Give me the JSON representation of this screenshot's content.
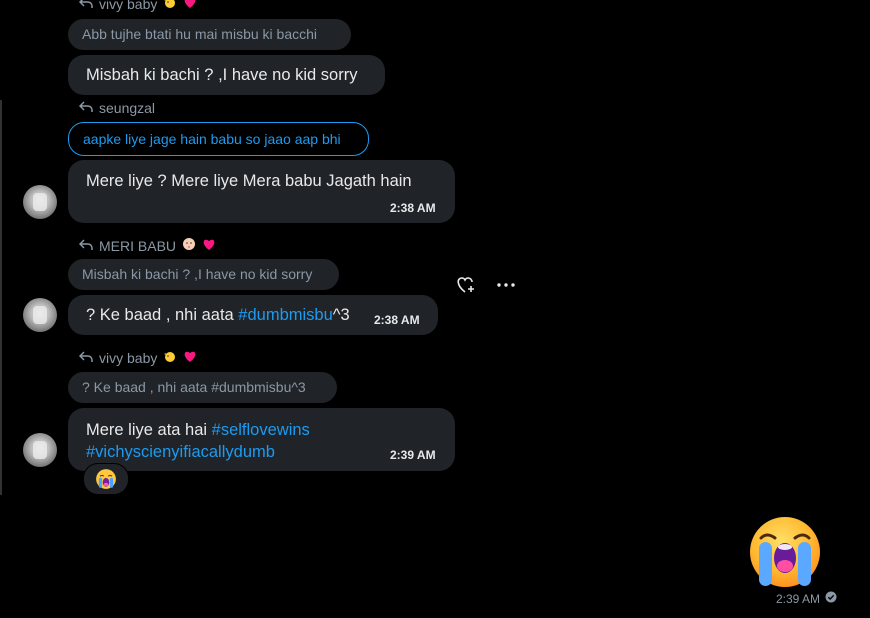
{
  "messages": [
    {
      "reply_to_name": "vivy baby",
      "quoted_text": "Abb tujhe btati hu mai misbu ki bacchi",
      "text": "Misbah ki bachi ? ,I have no kid sorry"
    },
    {
      "reply_to_name": "seungzal",
      "quoted_text": "aapke liye jage hain babu so jaao aap bhi",
      "text": "Mere liye ? Mere liye Mera babu Jagath hain",
      "time": "2:38 AM"
    },
    {
      "reply_to_name": "MERI BABU",
      "quoted_text": "Misbah ki bachi ? ,I have no kid sorry",
      "text_prefix": "? Ke baad , nhi aata ",
      "hashtag": "#dumbmisbu",
      "text_suffix": "^3",
      "time": "2:38 AM"
    },
    {
      "reply_to_name": "vivy baby",
      "quoted_text": "? Ke baad , nhi aata #dumbmisbu^3",
      "text_prefix": "Mere liye ata hai ",
      "hashtag_1": "#selflovewins",
      "hashtag_2": "#vichyscienyifiacallydumb",
      "time": "2:39 AM",
      "reaction": "loudly-crying-face"
    }
  ],
  "own_message": {
    "emoji": "loudly-crying-face",
    "time": "2:39 AM",
    "status": "sent"
  },
  "colors": {
    "background": "#000000",
    "bubble": "#202327",
    "link": "#1d9bf0",
    "muted": "#8b98a5",
    "heart": "#f91880"
  },
  "icons": [
    "reply-arrow-icon",
    "chick-emoji",
    "pink-heart-emoji",
    "baby-face-emoji",
    "heart-plus-icon",
    "more-icon",
    "check-circle-icon"
  ]
}
